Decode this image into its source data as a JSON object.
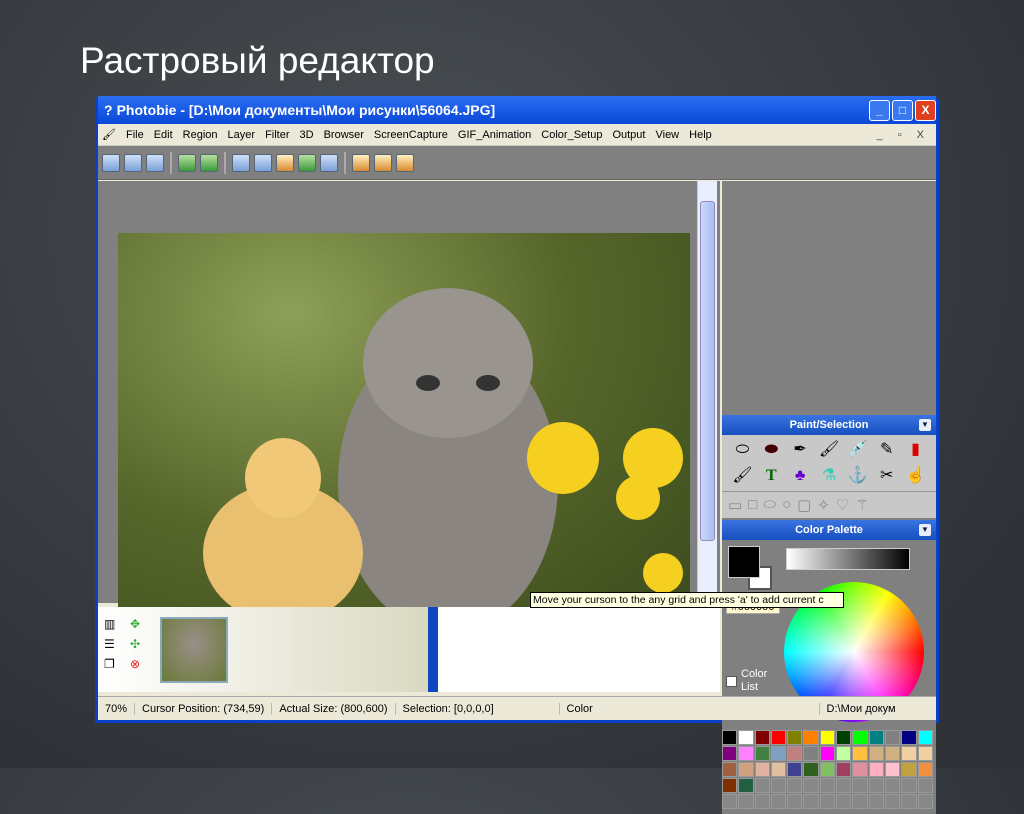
{
  "slide": {
    "title": "Растровый редактор"
  },
  "window": {
    "title": "Photobie - [D:\\Мои документы\\Мои рисунки\\56064.JPG]",
    "min": "_",
    "max": "□",
    "close": "X"
  },
  "menu": {
    "items": [
      "File",
      "Edit",
      "Region",
      "Layer",
      "Filter",
      "3D",
      "Browser",
      "ScreenCapture",
      "GIF_Animation",
      "Color_Setup",
      "Output",
      "View",
      "Help"
    ],
    "mdi_controls": "_ ▫ X"
  },
  "panels": {
    "paint": {
      "title": "Paint/Selection"
    },
    "palette": {
      "title": "Color Palette",
      "hex": "#000000",
      "color_list": "Color List"
    }
  },
  "palette_colors": [
    "#000000",
    "#ffffff",
    "#800000",
    "#ff0000",
    "#808000",
    "#ff8000",
    "#ffff00",
    "#004000",
    "#00ff00",
    "#008080",
    "#808080",
    "#000080",
    "#00ffff",
    "#800080",
    "#ff80ff",
    "#408040",
    "#80a0c0",
    "#c08080",
    "#808080",
    "#ff00ff",
    "#c0ffa0",
    "#ffc040",
    "#d0b080",
    "#d0b080",
    "#f0d0a0",
    "#f0d0a0",
    "#a06040",
    "#d0a080",
    "#e0b0a0",
    "#e0c0a0",
    "#404090",
    "#306020",
    "#80c060",
    "#a04060",
    "#e090a0",
    "#ffb0c0",
    "#ffc0d0",
    "#c0a040",
    "#f09040",
    "#803000",
    "#206040",
    "#888888",
    "#888888",
    "#888888",
    "#888888",
    "#888888",
    "#888888",
    "#888888",
    "#888888",
    "#888888",
    "#888888",
    "#888888",
    "#888888",
    "#888888",
    "#888888",
    "#888888",
    "#888888",
    "#888888",
    "#888888",
    "#888888",
    "#888888",
    "#888888",
    "#888888",
    "#888888",
    "#888888"
  ],
  "status": {
    "zoom": "70%",
    "cursor": "Cursor Position: (734,59)",
    "size": "Actual Size: (800,600)",
    "selection": "Selection: [0,0,0,0]",
    "color": "Color",
    "right": "D:\\Мои докум"
  },
  "tooltip": "Move your curson to the any grid and press 'a' to add current c"
}
